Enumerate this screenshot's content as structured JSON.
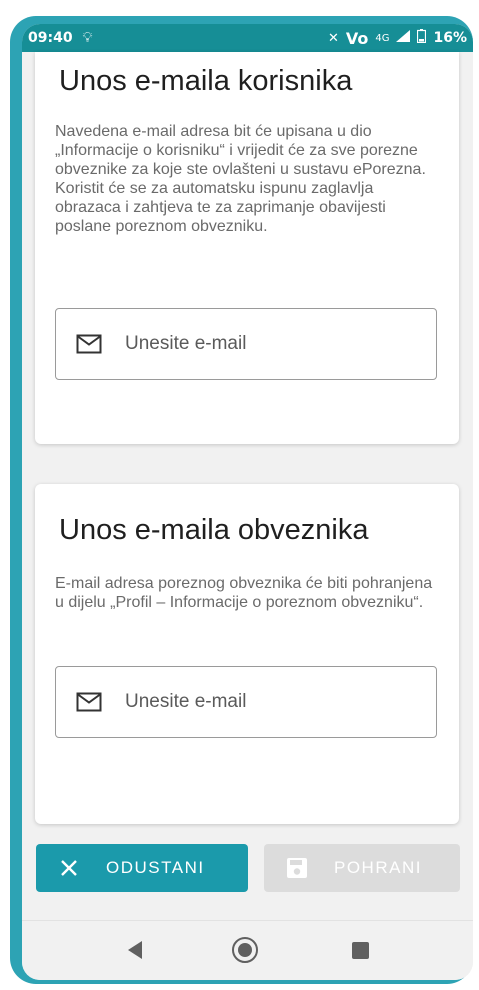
{
  "status_bar": {
    "time": "09:40",
    "volte": "Vo",
    "network": "4G",
    "battery": "16%"
  },
  "card_user": {
    "title": "Unos e-maila korisnika",
    "description": "Navedena e-mail adresa bit će upisana u dio „Informacije o korisniku“ i vrijedit će za sve porezne obveznike za koje ste ovlašteni u sustavu ePorezna. Koristit će se za automatsku ispunu zaglavlja obrazaca i zahtjeva te za zaprimanje obavijesti poslane poreznom obvezniku.",
    "email_placeholder": "Unesite e-mail",
    "email_value": ""
  },
  "card_taxpayer": {
    "title": "Unos e-maila obveznika",
    "description": "E-mail adresa poreznog obveznika će biti pohranjena u dijelu „Profil – Informacije o poreznom obvezniku“.",
    "email_placeholder": "Unesite e-mail",
    "email_value": ""
  },
  "actions": {
    "cancel_label": "ODUSTANI",
    "save_label": "POHRANI",
    "cancel_color": "#1b9aab",
    "save_disabled_color": "#dcdcdc"
  },
  "icons": {
    "email_field": "mail-icon",
    "cancel": "close-icon",
    "save": "save-icon",
    "nav_back": "back-triangle-icon",
    "nav_home": "home-circle-icon",
    "nav_recent": "recent-square-icon"
  },
  "colors": {
    "status_bar": "#168e96",
    "frame": "#2da3b4"
  }
}
